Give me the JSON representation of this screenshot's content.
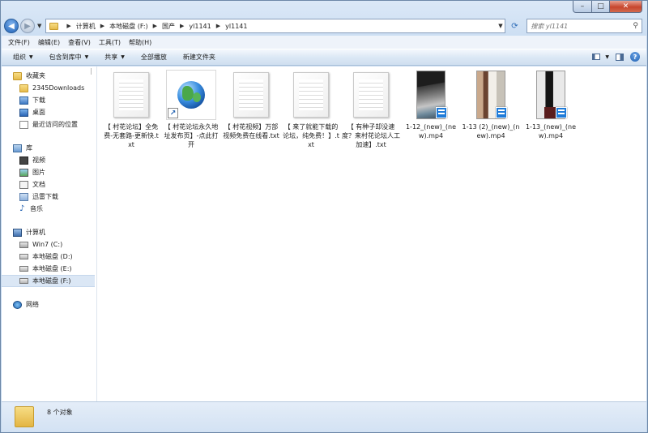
{
  "address": {
    "crumbs": [
      "计算机",
      "本地磁盘 (F:)",
      "国产",
      "yl1141",
      "yl1141"
    ],
    "search_placeholder": "搜索 yl1141"
  },
  "menu": [
    "文件(F)",
    "编辑(E)",
    "查看(V)",
    "工具(T)",
    "帮助(H)"
  ],
  "toolbar": {
    "organize": "组织",
    "include": "包含到库中",
    "share": "共享",
    "play_all": "全部播放",
    "new_folder": "新建文件夹"
  },
  "nav": {
    "favorites": {
      "title": "收藏夹",
      "items": [
        "2345Downloads",
        "下载",
        "桌面",
        "最近访问的位置"
      ]
    },
    "libraries": {
      "title": "库",
      "items": [
        "视频",
        "图片",
        "文档",
        "迅雷下载",
        "音乐"
      ]
    },
    "computer": {
      "title": "计算机",
      "items": [
        "Win7 (C:)",
        "本地磁盘 (D:)",
        "本地磁盘 (E:)",
        "本地磁盘 (F:)"
      ],
      "selected": "本地磁盘 (F:)"
    },
    "network": {
      "title": "网络"
    }
  },
  "files": [
    {
      "name": "【 村花论坛】全免费-无套路-更新快.txt",
      "icon": "text-file-icon"
    },
    {
      "name": "【 村花论坛永久地址发布页】-点此打开",
      "icon": "internet-shortcut-icon"
    },
    {
      "name": "【 村花视频】万部视频免费在线看.txt",
      "icon": "text-file-icon"
    },
    {
      "name": "【 来了就能下载的论坛，纯免费！】.txt",
      "icon": "text-file-icon"
    },
    {
      "name": "【 有种子却没速度？来村花论坛人工加速】.txt",
      "icon": "text-file-icon"
    },
    {
      "name": "1-12_(new)_(new).mp4",
      "icon": "video-thumbnail-icon"
    },
    {
      "name": "1-13 (2)_(new)_(new).mp4",
      "icon": "video-thumbnail-icon"
    },
    {
      "name": "1-13_(new)_(new).mp4",
      "icon": "video-thumbnail-icon"
    }
  ],
  "status": {
    "count": "8 个对象"
  }
}
